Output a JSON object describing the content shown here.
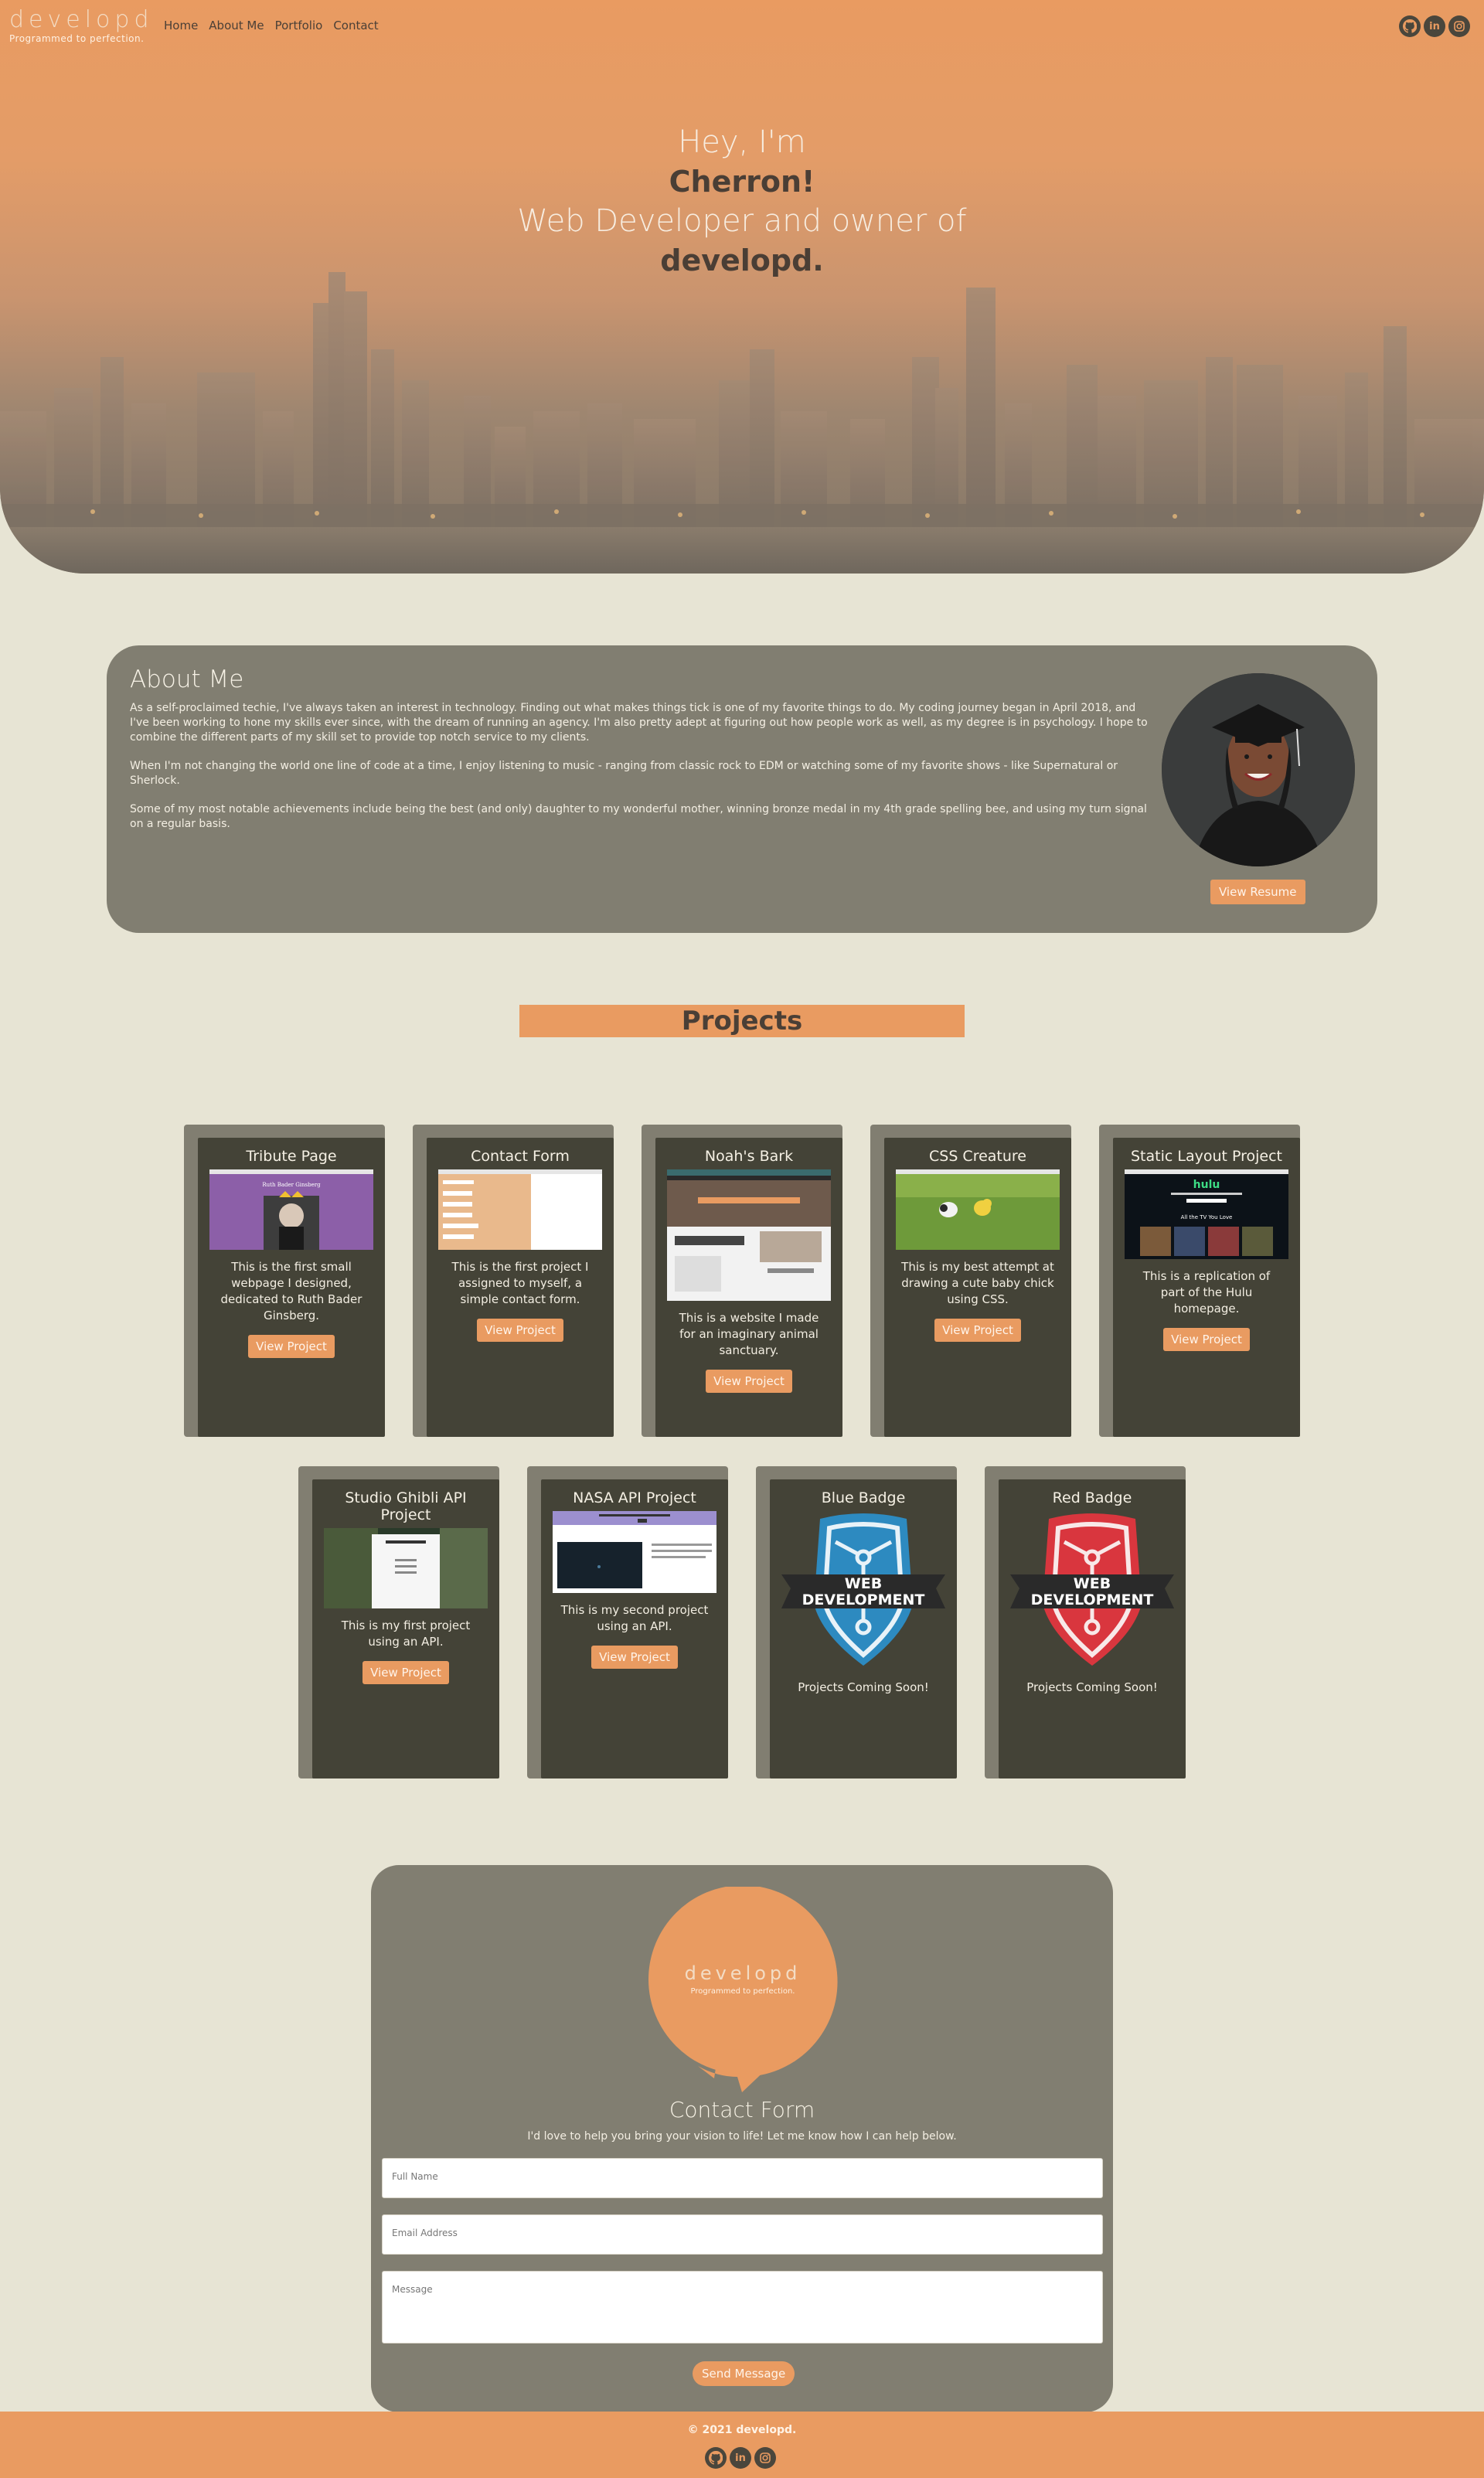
{
  "header": {
    "logo_text": "developd",
    "tagline": "Programmed to perfection.",
    "nav": [
      "Home",
      "About Me",
      "Portfolio",
      "Contact"
    ],
    "social_icons": [
      "github-icon",
      "linkedin-icon",
      "instagram-icon"
    ]
  },
  "hero": {
    "line1": "Hey, I'm",
    "line2": "Cherron!",
    "line3": "Web Developer and owner of",
    "line4": "developd."
  },
  "about": {
    "title": "About Me",
    "paragraphs": [
      "As a self-proclaimed techie, I've always taken an interest in technology. Finding out what makes things tick is one of my favorite things to do. My coding journey began in April 2018, and I've been working to hone my skills ever since, with the dream of running an agency. I'm also pretty adept at figuring out how people work as well, as my degree is in psychology. I hope to combine the different parts of my skill set to provide top notch service to my clients.",
      "When I'm not changing the world one line of code at a time, I enjoy listening to music - ranging from classic rock to EDM or watching some of my favorite shows - like Supernatural or Sherlock.",
      "Some of my most notable achievements include being the best (and only) daughter to my wonderful mother, winning bronze medal in my 4th grade spelling bee, and using my turn signal on a regular basis."
    ],
    "resume_button": "View Resume"
  },
  "projects": {
    "title": "Projects",
    "items": [
      {
        "title": "Tribute Page",
        "desc": "This is the first small webpage I designed, dedicated to Ruth Bader Ginsberg.",
        "button": "View Project"
      },
      {
        "title": "Contact Form",
        "desc": "This is the first project I assigned to myself, a simple contact form.",
        "button": "View Project"
      },
      {
        "title": "Noah's Bark",
        "desc": "This is a website I made for an imaginary animal sanctuary.",
        "button": "View Project"
      },
      {
        "title": "CSS Creature",
        "desc": "This is my best attempt at drawing a cute baby chick using CSS.",
        "button": "View Project"
      },
      {
        "title": "Static Layout Project",
        "desc": "This is a replication of part of the Hulu homepage.",
        "button": "View Project"
      },
      {
        "title": "Studio Ghibli API Project",
        "desc": "This is my first project using an API.",
        "button": "View Project"
      },
      {
        "title": "NASA API Project",
        "desc": "This is my second project using an API.",
        "button": "View Project"
      },
      {
        "title": "Blue Badge",
        "desc": "Projects Coming Soon!",
        "badge_text": [
          "WEB",
          "DEVELOPMENT"
        ]
      },
      {
        "title": "Red Badge",
        "desc": "Projects Coming Soon!",
        "badge_text": [
          "WEB",
          "DEVELOPMENT"
        ]
      }
    ],
    "thumb_text": {
      "tribute_title": "Ruth Bader Ginsberg",
      "hulu_logo": "hulu",
      "hulu_heading": "All the TV You Love"
    }
  },
  "contact": {
    "logo_text": "developd",
    "tagline": "Programmed to perfection.",
    "title": "Contact Form",
    "subtitle": "I'd love to help you bring your vision to life! Let me know how I can help below.",
    "name_placeholder": "Full Name",
    "email_placeholder": "Email Address",
    "message_placeholder": "Message",
    "send_button": "Send Message"
  },
  "footer": {
    "copyright": "© 2021 developd."
  },
  "colors": {
    "accent": "#e99b61",
    "background": "#e7e4d4",
    "panel": "#817e71",
    "card": "#444337",
    "dark_text": "#4a3f36"
  }
}
